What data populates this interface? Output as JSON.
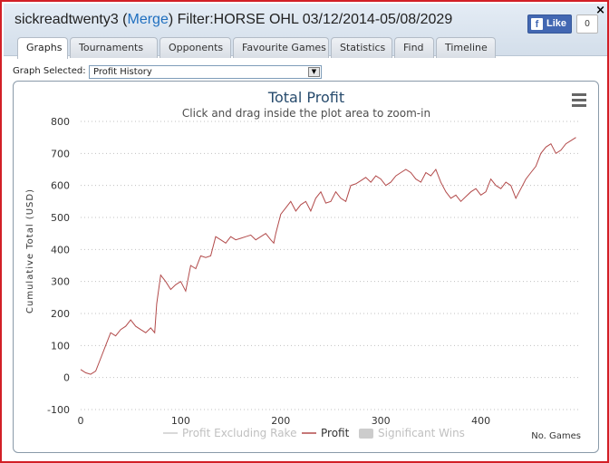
{
  "window": {
    "player": "sickreadtwenty3",
    "merge_label": "Merge",
    "filter_text": "Filter:HORSE OHL 03/12/2014-05/08/2029",
    "close_label": "×"
  },
  "facebook": {
    "like_label": "Like",
    "like_count": "0"
  },
  "tabs": [
    {
      "label": "Graphs",
      "active": true
    },
    {
      "label": "Tournaments"
    },
    {
      "label": "Opponents"
    },
    {
      "label": "Favourite Games"
    },
    {
      "label": "Statistics"
    },
    {
      "label": "Find"
    },
    {
      "label": "Timeline"
    }
  ],
  "graph_selector": {
    "label": "Graph Selected:",
    "value": "Profit History"
  },
  "chart_data": {
    "type": "line",
    "title": "Total Profit",
    "subtitle": "Click and drag inside the plot area to zoom-in",
    "ylabel": "Cumulative Total (USD)",
    "xlabel": "No. Games",
    "xlim": [
      0,
      500
    ],
    "ylim": [
      -100,
      800
    ],
    "xticks": [
      0,
      100,
      200,
      300,
      400
    ],
    "yticks": [
      -100,
      0,
      100,
      200,
      300,
      400,
      500,
      600,
      700,
      800
    ],
    "grid": "horizontal dotted",
    "legend_position": "bottom-center",
    "legend": [
      {
        "name": "Profit Excluding Rake",
        "color": "#cccccc",
        "enabled": false
      },
      {
        "name": "Profit",
        "color": "#b24a4a",
        "enabled": true
      },
      {
        "name": "Significant Wins",
        "color": "#cccccc",
        "enabled": false
      }
    ],
    "series": [
      {
        "name": "Profit",
        "color": "#b24a4a",
        "x": [
          0,
          5,
          10,
          15,
          20,
          25,
          30,
          35,
          40,
          45,
          50,
          55,
          60,
          65,
          70,
          74,
          76,
          80,
          85,
          90,
          95,
          100,
          105,
          110,
          115,
          120,
          125,
          130,
          135,
          140,
          145,
          150,
          155,
          160,
          165,
          170,
          175,
          180,
          185,
          190,
          193,
          195,
          200,
          205,
          210,
          215,
          220,
          225,
          230,
          235,
          240,
          245,
          250,
          255,
          260,
          265,
          270,
          275,
          280,
          285,
          290,
          295,
          300,
          305,
          310,
          315,
          320,
          325,
          330,
          335,
          340,
          345,
          350,
          355,
          360,
          365,
          370,
          375,
          380,
          385,
          390,
          395,
          400,
          405,
          410,
          415,
          420,
          425,
          430,
          435,
          440,
          445,
          450,
          455,
          460,
          465,
          470,
          475,
          480,
          485,
          490,
          495
        ],
        "y": [
          25,
          15,
          10,
          20,
          60,
          100,
          140,
          130,
          150,
          160,
          180,
          160,
          150,
          140,
          155,
          140,
          230,
          320,
          300,
          275,
          290,
          300,
          270,
          350,
          340,
          380,
          375,
          380,
          440,
          430,
          420,
          440,
          430,
          435,
          440,
          445,
          430,
          440,
          450,
          430,
          420,
          450,
          510,
          530,
          550,
          520,
          540,
          550,
          520,
          560,
          580,
          545,
          550,
          580,
          560,
          550,
          600,
          605,
          615,
          625,
          610,
          630,
          620,
          600,
          610,
          630,
          640,
          650,
          640,
          620,
          610,
          640,
          630,
          650,
          610,
          580,
          560,
          570,
          550,
          565,
          580,
          590,
          570,
          580,
          620,
          600,
          590,
          610,
          600,
          560,
          590,
          620,
          640,
          660,
          700,
          720,
          730,
          700,
          710,
          730,
          740,
          750
        ]
      }
    ]
  }
}
